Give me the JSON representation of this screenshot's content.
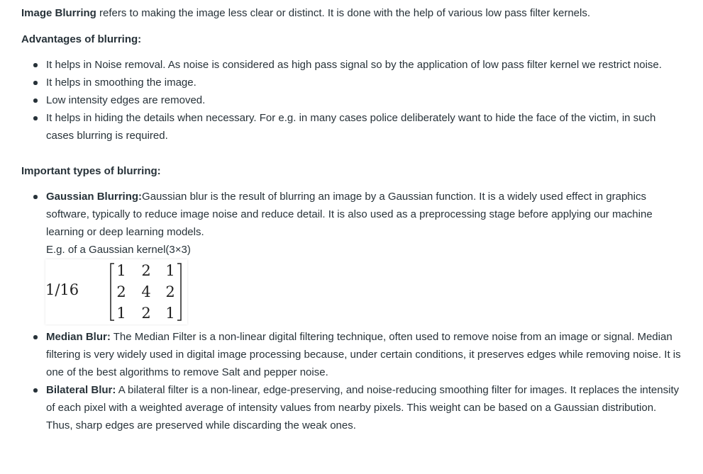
{
  "intro": {
    "term": "Image Blurring",
    "text": " refers to making the image less clear or distinct. It is done with the help of various low pass filter kernels."
  },
  "advantages": {
    "heading": "Advantages of blurring:",
    "items": [
      "It helps in Noise removal. As noise is considered as high pass signal so by the application of low pass filter kernel we restrict noise.",
      "It helps in smoothing the image.",
      "Low intensity edges are removed.",
      "It helps in hiding the details when necessary. For e.g. in many cases police deliberately want to hide the face of the victim, in such cases blurring is required."
    ]
  },
  "types": {
    "heading": "Important types of blurring:",
    "gaussian": {
      "term": "Gaussian Blurring:",
      "text": "Gaussian blur is the result of blurring an image by a Gaussian function. It is a widely used effect in graphics software, typically to reduce image noise and reduce detail. It is also used as a preprocessing stage before applying our machine learning or deep learning models.",
      "example_label": "E.g. of a Gaussian kernel(3×3)",
      "kernel": {
        "factor": "1/16",
        "rows": [
          [
            "1",
            "2",
            "1"
          ],
          [
            "2",
            "4",
            "2"
          ],
          [
            "1",
            "2",
            "1"
          ]
        ]
      }
    },
    "median": {
      "term": "Median Blur:",
      "text": " The Median Filter is a non-linear digital filtering technique, often used to remove noise from an image or signal. Median filtering is very widely used in digital image processing because, under certain conditions, it preserves edges while removing noise. It is one of the best algorithms to remove Salt and pepper noise."
    },
    "bilateral": {
      "term": "Bilateral Blur:",
      "text": " A bilateral filter is a non-linear, edge-preserving, and noise-reducing smoothing filter for images. It replaces the intensity of each pixel with a weighted average of intensity values from nearby pixels. This weight can be based on a Gaussian distribution. Thus, sharp edges are preserved while discarding the weak ones."
    }
  }
}
